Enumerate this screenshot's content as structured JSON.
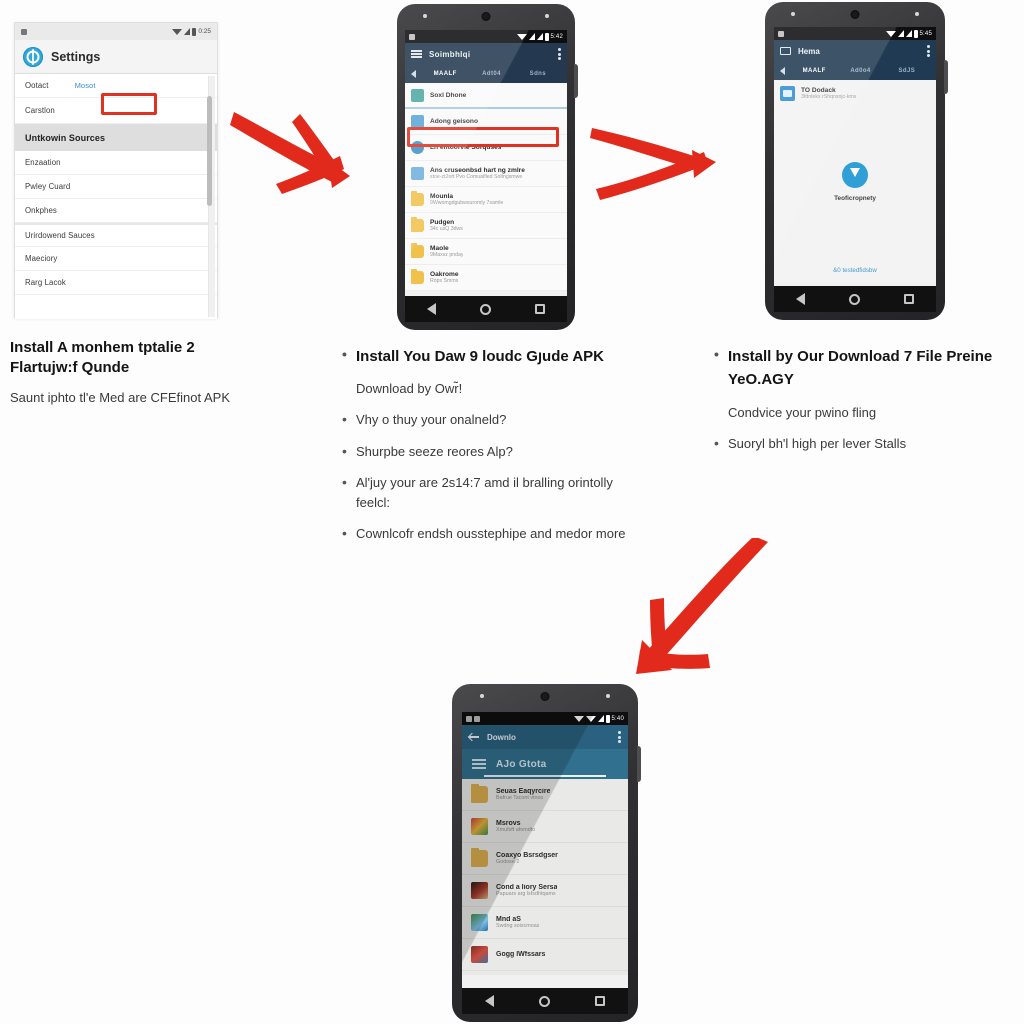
{
  "panel1": {
    "status": {
      "time": "0:25",
      "icons": [
        "chip-icon",
        "wifi-icon",
        "signal-icon",
        "bluetooth-icon",
        "battery-icon"
      ]
    },
    "title": "Settings",
    "gear_icon": "settings-gear-icon",
    "rows": [
      {
        "label": "Ootact",
        "value": "Mosot",
        "highlighted": false,
        "boxed": true
      },
      {
        "label": "Carstlon",
        "value": "",
        "highlighted": false,
        "boxed": false
      },
      {
        "label": "Untkowin Sources",
        "value": "",
        "highlighted": true,
        "boxed": false
      },
      {
        "label": "Enzaation",
        "value": "",
        "highlighted": false,
        "boxed": false
      },
      {
        "label": "Pwley Cuard",
        "value": "",
        "highlighted": false,
        "boxed": false
      },
      {
        "label": "Onkphes",
        "value": "",
        "highlighted": false,
        "boxed": false
      },
      {
        "label": "Urirdowend Sauces",
        "value": "",
        "highlighted": false,
        "boxed": false
      },
      {
        "label": "Maeciory",
        "value": "",
        "highlighted": false,
        "boxed": false
      },
      {
        "label": "Rarg Lacok",
        "value": "",
        "highlighted": false,
        "boxed": false
      }
    ],
    "accent": "#2fa8dd",
    "highlight_box_color": "#e03223"
  },
  "caption1": {
    "title": "Install A monhem tptalie 2 Flartujw:f Qunde",
    "body": "Saunt iphto tl'e Med are CFEfinot APK"
  },
  "caption2": {
    "items": [
      {
        "text": "Install You Daw 9 loudc Gյude APK",
        "bullet": true,
        "strong": true
      },
      {
        "text": "Download by Owr̃!",
        "bullet": false,
        "strong": false
      },
      {
        "text": "Vhy o thuy your onalneld?",
        "bullet": true,
        "strong": false
      },
      {
        "text": "Shurpbe seeze reores Alp?",
        "bullet": true,
        "strong": false
      },
      {
        "text": "Al'juy your are 2s14:7 amd il bralling orintolly feelcl:",
        "bullet": true,
        "strong": false
      },
      {
        "text": "Cownlcofr endsh ousstephipe and medor more",
        "bullet": true,
        "strong": false
      }
    ]
  },
  "caption3": {
    "items": [
      {
        "text": "Install by Our Download 7 File Preine YeO.AGY",
        "bullet": true,
        "strong": true
      },
      {
        "text": "Condvice your pwino fling",
        "bullet": false,
        "strong": false
      },
      {
        "text": "Suoryl bh'l high per lever Stalls",
        "bullet": true,
        "strong": false
      }
    ]
  },
  "phone2": {
    "statusbar": {
      "time": "5:42"
    },
    "appbar": {
      "title": "Soimbhlqi",
      "menu_icon": "hamburger-icon",
      "overflow_icon": "kebab-menu-icon"
    },
    "tabs": {
      "back_icon": "chevron-left-icon",
      "items": [
        "MAALF",
        "Adt04",
        "Sdns"
      ],
      "active_index": 0
    },
    "rows": [
      {
        "title": "Soxl Dhone",
        "subtitle": "",
        "icon": "device-icon"
      },
      {
        "title": "Adong geisono",
        "subtitle": "",
        "icon": "storage-icon"
      },
      {
        "title": "Ln ehtoorvie Sorquses",
        "subtitle": "",
        "icon": "disc-icon",
        "boxed": true
      },
      {
        "title": "Ans cruseonbsd hart ng zmlre",
        "subtitle": "stoe-zt2ort Pvo Comuaified Soltngsmwe",
        "icon": "sd-icon"
      },
      {
        "title": "Mounla",
        "subtitle": "9Wwomgdgubwsuromly 7samle",
        "icon": "folder-icon"
      },
      {
        "title": "Pudgen",
        "subtitle": "34c usQ 3dws",
        "icon": "folder-icon"
      },
      {
        "title": "Maole",
        "subtitle": "9Maxsz pnday",
        "icon": "folder-icon"
      },
      {
        "title": "Oakrome",
        "subtitle": "Rops Smms",
        "icon": "folder-icon"
      }
    ],
    "highlight_box_color": "#e03223"
  },
  "phone3": {
    "statusbar": {
      "time": "5:45"
    },
    "appbar": {
      "title": "Hema",
      "left_icon": "mail-icon",
      "overflow_icon": "kebab-menu-icon"
    },
    "tabs": {
      "back_icon": "chevron-left-icon",
      "items": [
        "MAALF",
        "Ad0o4",
        "SdJS"
      ],
      "active_index": 0
    },
    "item": {
      "title": "TO Dodack",
      "subtitle": "3fdnteks rShqnsnjc-kms",
      "icon": "file-icon"
    },
    "download": {
      "icon": "download-arrow-icon",
      "label": "Teoficropnety"
    },
    "footer": "&0 testedfidsbw"
  },
  "phone4": {
    "statusbar": {
      "time": "5:40"
    },
    "appbar": {
      "title": "Downlo",
      "back_icon": "arrow-left-icon",
      "overflow_icon": "kebab-menu-icon"
    },
    "search": {
      "menu_icon": "hamburger-icon",
      "value": "AJo Gtota"
    },
    "rows": [
      {
        "title": "Seuas Eaqyrcire",
        "subtitle": "Bafrue Tscont vtnos",
        "icon": "folder-icon"
      },
      {
        "title": "Msrovs",
        "subtitle": "Xmufsft afomdto",
        "icon": "app-icon-1"
      },
      {
        "title": "Coaxyo Bsrsdgser",
        "subtitle": "Godose 2",
        "icon": "folder-icon"
      },
      {
        "title": "Cond a liory Sersa",
        "subtitle": "Papuars arg lsfsdhtqams",
        "icon": "app-icon-2"
      },
      {
        "title": "Mnd aS",
        "subtitle": "Swdng soiscmoas",
        "icon": "app-icon-3"
      },
      {
        "title": "Gogg lWfssars",
        "subtitle": "",
        "icon": "app-icon-4"
      }
    ]
  },
  "arrows": {
    "color": "#e1291c",
    "items": [
      {
        "name": "arrow-step1-to-step2",
        "direction": "down-right"
      },
      {
        "name": "arrow-step2-to-step3",
        "direction": "right"
      },
      {
        "name": "arrow-step3-to-step4",
        "direction": "down-left"
      }
    ]
  },
  "navbar": {
    "back_icon": "nav-back-icon",
    "home_icon": "nav-home-icon",
    "recents_icon": "nav-recents-icon"
  }
}
